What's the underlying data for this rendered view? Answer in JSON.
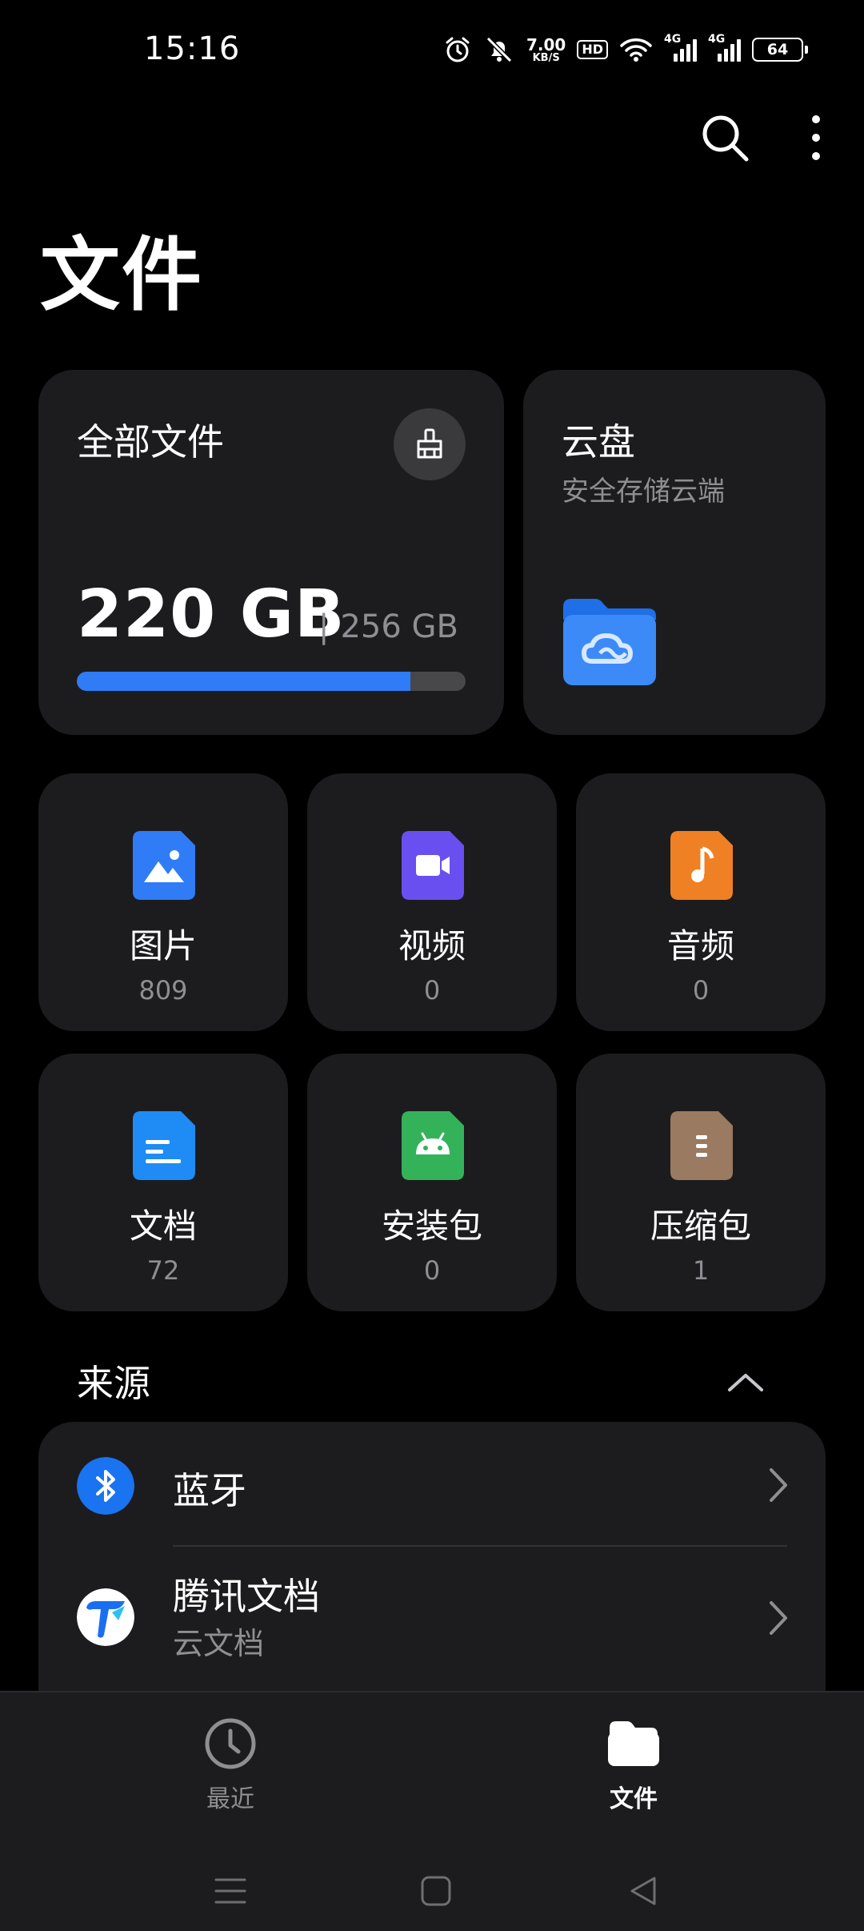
{
  "status_bar": {
    "time": "15:16",
    "net_speed_value": "7.00",
    "net_speed_unit": "KB/S",
    "hd_label": "HD",
    "signal_1_label": "4G",
    "signal_2_label": "4G",
    "battery": "64"
  },
  "page": {
    "title": "文件"
  },
  "storage": {
    "title": "全部文件",
    "used": "220 GB",
    "separator": "|",
    "total": "256 GB",
    "usage_fraction": 0.859,
    "accent": "#2f7cf6"
  },
  "cloud": {
    "title": "云盘",
    "subtitle": "安全存储云端"
  },
  "categories": [
    {
      "name": "图片",
      "count": "809",
      "icon": "image-icon",
      "color": "#2f7cf6"
    },
    {
      "name": "视频",
      "count": "0",
      "icon": "video-icon",
      "color": "#6a4ff0"
    },
    {
      "name": "音频",
      "count": "0",
      "icon": "music-icon",
      "color": "#f08024"
    },
    {
      "name": "文档",
      "count": "72",
      "icon": "document-icon",
      "color": "#1e8cf4"
    },
    {
      "name": "安装包",
      "count": "0",
      "icon": "android-icon",
      "color": "#34b25a"
    },
    {
      "name": "压缩包",
      "count": "1",
      "icon": "archive-icon",
      "color": "#9a7a60"
    }
  ],
  "sources": {
    "heading": "来源",
    "items": [
      {
        "label": "蓝牙",
        "sublabel": "",
        "icon": "bluetooth-icon"
      },
      {
        "label": "腾讯文档",
        "sublabel": "云文档",
        "icon": "tencent-docs-icon"
      }
    ]
  },
  "bottom_nav": {
    "tabs": [
      {
        "label": "最近",
        "icon": "clock-icon",
        "active": false
      },
      {
        "label": "文件",
        "icon": "folder-icon",
        "active": true
      }
    ]
  }
}
